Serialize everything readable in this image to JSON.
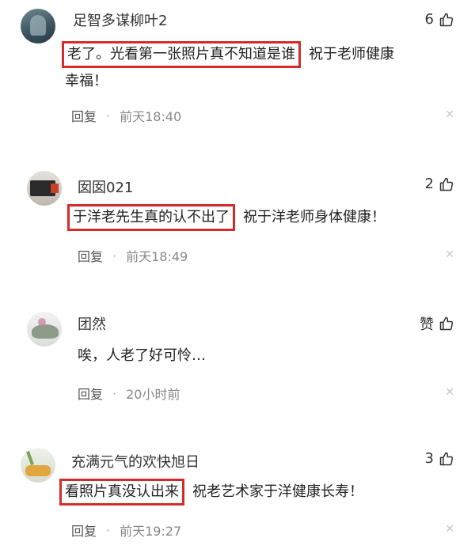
{
  "comments": [
    {
      "username": "足智多谋柳叶2",
      "likes": "6",
      "highlight": "老了。光看第一张照片真不知道是谁",
      "rest_line1": "祝于老师健康",
      "rest_line2": "幸福！",
      "reply": "回复",
      "time": "前天18:40"
    },
    {
      "username": "囡囡021",
      "likes": "2",
      "highlight": "于洋老先生真的认不出了",
      "rest_line1": "祝于洋老师身体健康！",
      "reply": "回复",
      "time": "前天18:49"
    },
    {
      "username": "团然",
      "likes": "赞",
      "text": "唉，人老了好可怜…",
      "reply": "回复",
      "time": "20小时前"
    },
    {
      "username": "充满元气的欢快旭日",
      "likes": "3",
      "highlight": "看照片真没认出来",
      "rest_line1": "祝老艺术家于洋健康长寿！",
      "reply": "回复",
      "time": "前天19:27"
    }
  ],
  "separator": "·",
  "close_glyph": "✕",
  "colors": {
    "highlight_border": "#d42c2c"
  }
}
